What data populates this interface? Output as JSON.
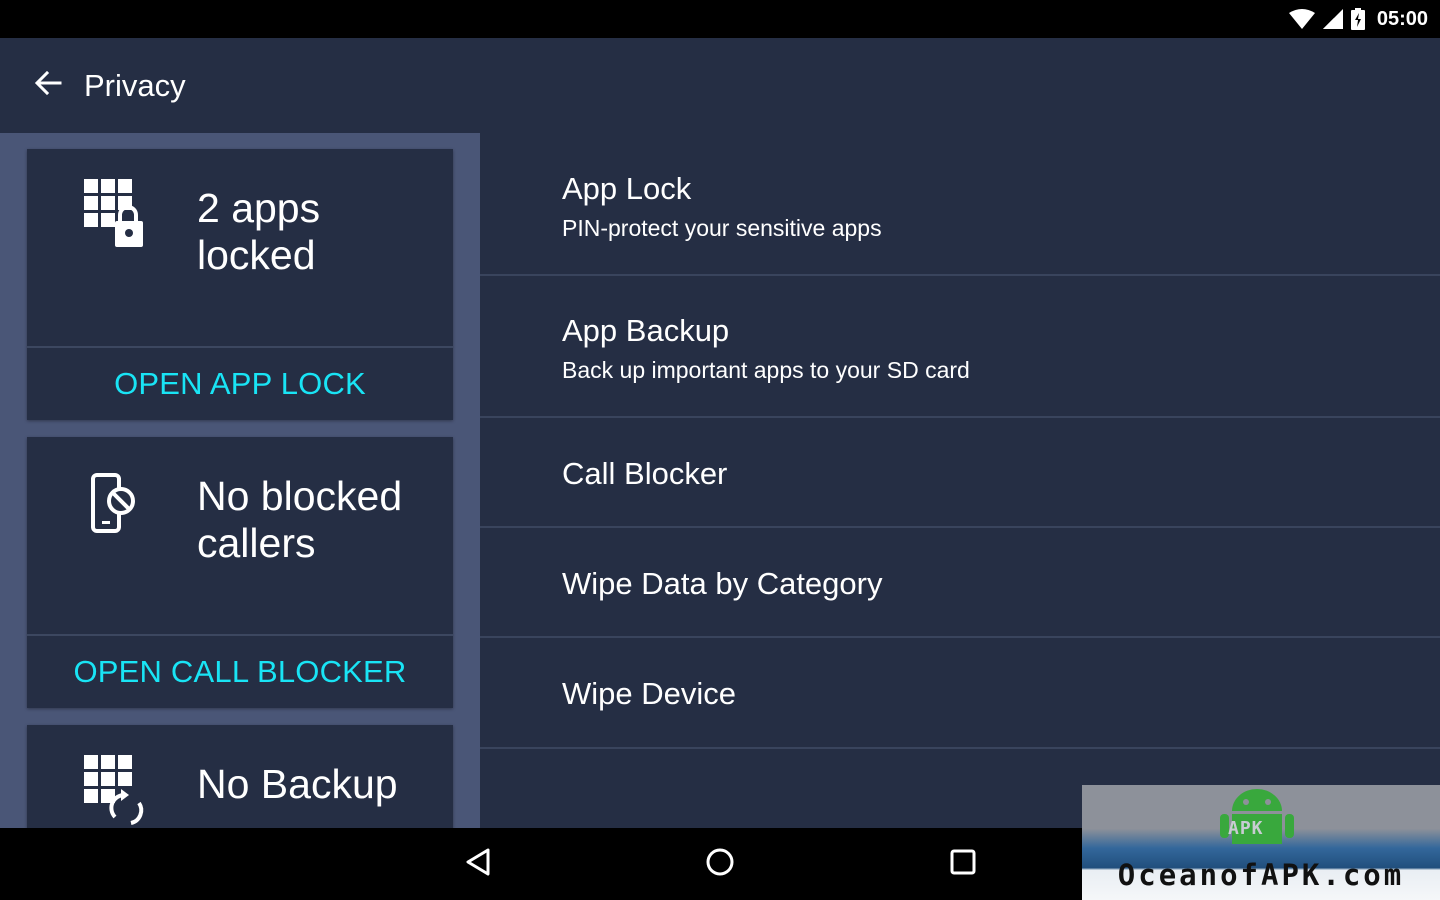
{
  "status_bar": {
    "time": "05:00",
    "icons": [
      "wifi-icon",
      "signal-icon",
      "battery-icon"
    ]
  },
  "app_bar": {
    "title": "Privacy",
    "back_icon": "arrow-back-icon"
  },
  "cards": [
    {
      "icon": "app-lock-grid-icon",
      "text": "2 apps locked",
      "action": "OPEN APP LOCK"
    },
    {
      "icon": "blocked-phone-icon",
      "text": "No blocked callers",
      "action": "OPEN CALL BLOCKER"
    },
    {
      "icon": "backup-grid-icon",
      "text": "No Backup"
    }
  ],
  "menu": [
    {
      "title": "App Lock",
      "subtitle": "PIN-protect your sensitive apps"
    },
    {
      "title": "App Backup",
      "subtitle": "Back up important apps to your SD card"
    },
    {
      "title": "Call Blocker"
    },
    {
      "title": "Wipe Data by Category"
    },
    {
      "title": "Wipe Device"
    }
  ],
  "nav_bar": {
    "icons": [
      "nav-back-icon",
      "nav-home-icon",
      "nav-recents-icon"
    ]
  },
  "watermark": {
    "text": "OceanofAPK.com",
    "badge": "APK"
  },
  "colors": {
    "background": "#252e44",
    "left_panel": "#4a5677",
    "accent": "#19e4f5",
    "text": "#ffffff"
  }
}
